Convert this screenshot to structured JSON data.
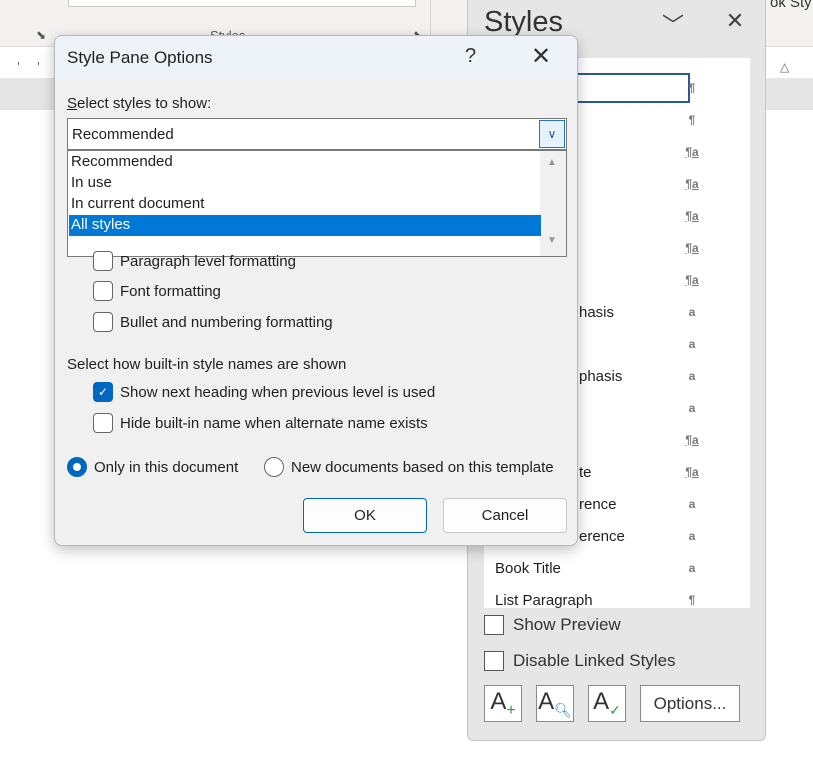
{
  "ribbon": {
    "group_label": "Styles",
    "right_fragment": "ok Sty"
  },
  "styles_pane": {
    "title": "Styles",
    "items": [
      {
        "name": "",
        "icon": "¶",
        "icon_type": "paragraph",
        "selected": true
      },
      {
        "name": "",
        "icon": "¶",
        "icon_type": "paragraph"
      },
      {
        "name": "",
        "icon": "¶a",
        "icon_type": "linked"
      },
      {
        "name": "",
        "icon": "¶a",
        "icon_type": "linked"
      },
      {
        "name": "",
        "icon": "¶a",
        "icon_type": "linked"
      },
      {
        "name": "",
        "icon": "¶a",
        "icon_type": "linked"
      },
      {
        "name": "",
        "icon": "¶a",
        "icon_type": "linked"
      },
      {
        "name": "hasis",
        "icon": "a",
        "icon_type": "character"
      },
      {
        "name": "",
        "icon": "a",
        "icon_type": "character"
      },
      {
        "name": "phasis",
        "icon": "a",
        "icon_type": "character"
      },
      {
        "name": "",
        "icon": "a",
        "icon_type": "character"
      },
      {
        "name": "",
        "icon": "¶a",
        "icon_type": "linked"
      },
      {
        "name": "te",
        "icon": "¶a",
        "icon_type": "linked"
      },
      {
        "name": "rence",
        "icon": "a",
        "icon_type": "character"
      },
      {
        "name": "erence",
        "icon": "a",
        "icon_type": "character"
      },
      {
        "name": "Book Title",
        "icon": "a",
        "icon_type": "character"
      },
      {
        "name": "List Paragraph",
        "icon": "¶",
        "icon_type": "paragraph"
      }
    ],
    "show_preview": {
      "label": "Show Preview",
      "checked": false
    },
    "disable_linked": {
      "label": "Disable Linked Styles",
      "checked": false
    },
    "options_label": "Options..."
  },
  "dialog": {
    "title": "Style Pane Options",
    "help": "?",
    "select_label": "Select styles to show:",
    "combo_value": "Recommended",
    "options": [
      "Recommended",
      "In use",
      "In current document",
      "All styles"
    ],
    "highlighted": "All styles",
    "formatting": [
      {
        "label": "Paragraph level formatting",
        "checked": false
      },
      {
        "label": "Font formatting",
        "checked": false
      },
      {
        "label": "Bullet and numbering formatting",
        "checked": false
      }
    ],
    "names_label": "Select how built-in style names are shown",
    "name_options": [
      {
        "label": "Show next heading when previous level is used",
        "checked": true
      },
      {
        "label": "Hide built-in name when alternate name exists",
        "checked": false
      }
    ],
    "scope": [
      {
        "label": "Only in this document",
        "selected": true
      },
      {
        "label": "New documents based on this template",
        "selected": false
      }
    ],
    "ok": "OK",
    "cancel": "Cancel"
  },
  "colors": {
    "accent": "#0067c0",
    "highlight": "#0078d7",
    "selection_border": "#2b579a"
  }
}
